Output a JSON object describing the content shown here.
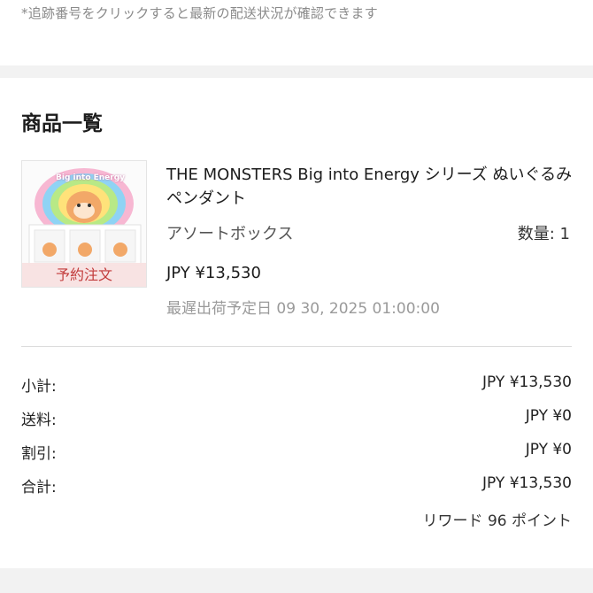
{
  "note": "*追跡番号をクリックすると最新の配送状況が確認できます",
  "section_title": "商品一覧",
  "product": {
    "name": "THE MONSTERS Big into Energy シリーズ ぬいぐるみペンダント",
    "variant": "アソートボックス",
    "quantity": "数量: 1",
    "price": "JPY ¥13,530",
    "ship_date": "最遅出荷予定日 09 30, 2025 01:00:00",
    "badge": "予約注文",
    "thumbnail_logo_text": "Big into Energy"
  },
  "summary": {
    "subtotal_label": "小計:",
    "subtotal_value": "JPY ¥13,530",
    "shipping_label": "送料:",
    "shipping_value": "JPY ¥0",
    "discount_label": "割引:",
    "discount_value": "JPY ¥0",
    "total_label": "合計:",
    "total_value": "JPY ¥13,530",
    "reward": "リワード 96 ポイント"
  },
  "colors": {
    "band": "#f2f2f2",
    "badge_text": "#c23b3b",
    "badge_bg": "#f8e2e2",
    "muted": "#9a9a9a"
  }
}
